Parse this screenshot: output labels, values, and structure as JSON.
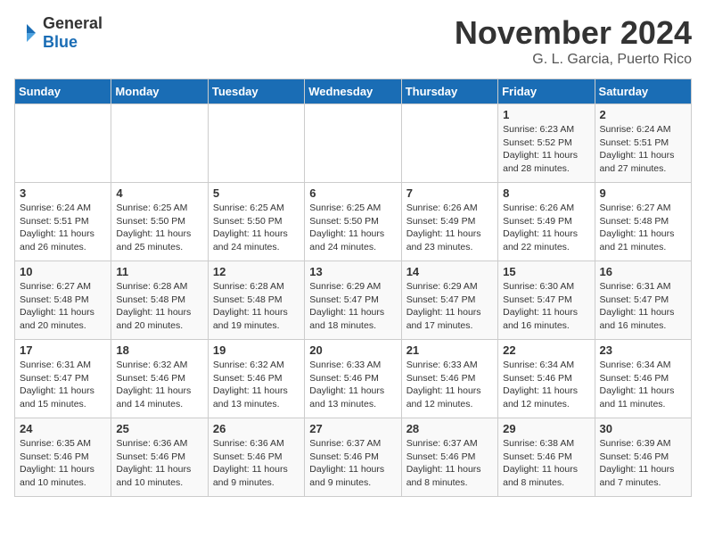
{
  "header": {
    "logo_general": "General",
    "logo_blue": "Blue",
    "title": "November 2024",
    "location": "G. L. Garcia, Puerto Rico"
  },
  "weekdays": [
    "Sunday",
    "Monday",
    "Tuesday",
    "Wednesday",
    "Thursday",
    "Friday",
    "Saturday"
  ],
  "rows": [
    [
      {
        "day": "",
        "info": ""
      },
      {
        "day": "",
        "info": ""
      },
      {
        "day": "",
        "info": ""
      },
      {
        "day": "",
        "info": ""
      },
      {
        "day": "",
        "info": ""
      },
      {
        "day": "1",
        "info": "Sunrise: 6:23 AM\nSunset: 5:52 PM\nDaylight: 11 hours and 28 minutes."
      },
      {
        "day": "2",
        "info": "Sunrise: 6:24 AM\nSunset: 5:51 PM\nDaylight: 11 hours and 27 minutes."
      }
    ],
    [
      {
        "day": "3",
        "info": "Sunrise: 6:24 AM\nSunset: 5:51 PM\nDaylight: 11 hours and 26 minutes."
      },
      {
        "day": "4",
        "info": "Sunrise: 6:25 AM\nSunset: 5:50 PM\nDaylight: 11 hours and 25 minutes."
      },
      {
        "day": "5",
        "info": "Sunrise: 6:25 AM\nSunset: 5:50 PM\nDaylight: 11 hours and 24 minutes."
      },
      {
        "day": "6",
        "info": "Sunrise: 6:25 AM\nSunset: 5:50 PM\nDaylight: 11 hours and 24 minutes."
      },
      {
        "day": "7",
        "info": "Sunrise: 6:26 AM\nSunset: 5:49 PM\nDaylight: 11 hours and 23 minutes."
      },
      {
        "day": "8",
        "info": "Sunrise: 6:26 AM\nSunset: 5:49 PM\nDaylight: 11 hours and 22 minutes."
      },
      {
        "day": "9",
        "info": "Sunrise: 6:27 AM\nSunset: 5:48 PM\nDaylight: 11 hours and 21 minutes."
      }
    ],
    [
      {
        "day": "10",
        "info": "Sunrise: 6:27 AM\nSunset: 5:48 PM\nDaylight: 11 hours and 20 minutes."
      },
      {
        "day": "11",
        "info": "Sunrise: 6:28 AM\nSunset: 5:48 PM\nDaylight: 11 hours and 20 minutes."
      },
      {
        "day": "12",
        "info": "Sunrise: 6:28 AM\nSunset: 5:48 PM\nDaylight: 11 hours and 19 minutes."
      },
      {
        "day": "13",
        "info": "Sunrise: 6:29 AM\nSunset: 5:47 PM\nDaylight: 11 hours and 18 minutes."
      },
      {
        "day": "14",
        "info": "Sunrise: 6:29 AM\nSunset: 5:47 PM\nDaylight: 11 hours and 17 minutes."
      },
      {
        "day": "15",
        "info": "Sunrise: 6:30 AM\nSunset: 5:47 PM\nDaylight: 11 hours and 16 minutes."
      },
      {
        "day": "16",
        "info": "Sunrise: 6:31 AM\nSunset: 5:47 PM\nDaylight: 11 hours and 16 minutes."
      }
    ],
    [
      {
        "day": "17",
        "info": "Sunrise: 6:31 AM\nSunset: 5:47 PM\nDaylight: 11 hours and 15 minutes."
      },
      {
        "day": "18",
        "info": "Sunrise: 6:32 AM\nSunset: 5:46 PM\nDaylight: 11 hours and 14 minutes."
      },
      {
        "day": "19",
        "info": "Sunrise: 6:32 AM\nSunset: 5:46 PM\nDaylight: 11 hours and 13 minutes."
      },
      {
        "day": "20",
        "info": "Sunrise: 6:33 AM\nSunset: 5:46 PM\nDaylight: 11 hours and 13 minutes."
      },
      {
        "day": "21",
        "info": "Sunrise: 6:33 AM\nSunset: 5:46 PM\nDaylight: 11 hours and 12 minutes."
      },
      {
        "day": "22",
        "info": "Sunrise: 6:34 AM\nSunset: 5:46 PM\nDaylight: 11 hours and 12 minutes."
      },
      {
        "day": "23",
        "info": "Sunrise: 6:34 AM\nSunset: 5:46 PM\nDaylight: 11 hours and 11 minutes."
      }
    ],
    [
      {
        "day": "24",
        "info": "Sunrise: 6:35 AM\nSunset: 5:46 PM\nDaylight: 11 hours and 10 minutes."
      },
      {
        "day": "25",
        "info": "Sunrise: 6:36 AM\nSunset: 5:46 PM\nDaylight: 11 hours and 10 minutes."
      },
      {
        "day": "26",
        "info": "Sunrise: 6:36 AM\nSunset: 5:46 PM\nDaylight: 11 hours and 9 minutes."
      },
      {
        "day": "27",
        "info": "Sunrise: 6:37 AM\nSunset: 5:46 PM\nDaylight: 11 hours and 9 minutes."
      },
      {
        "day": "28",
        "info": "Sunrise: 6:37 AM\nSunset: 5:46 PM\nDaylight: 11 hours and 8 minutes."
      },
      {
        "day": "29",
        "info": "Sunrise: 6:38 AM\nSunset: 5:46 PM\nDaylight: 11 hours and 8 minutes."
      },
      {
        "day": "30",
        "info": "Sunrise: 6:39 AM\nSunset: 5:46 PM\nDaylight: 11 hours and 7 minutes."
      }
    ]
  ]
}
